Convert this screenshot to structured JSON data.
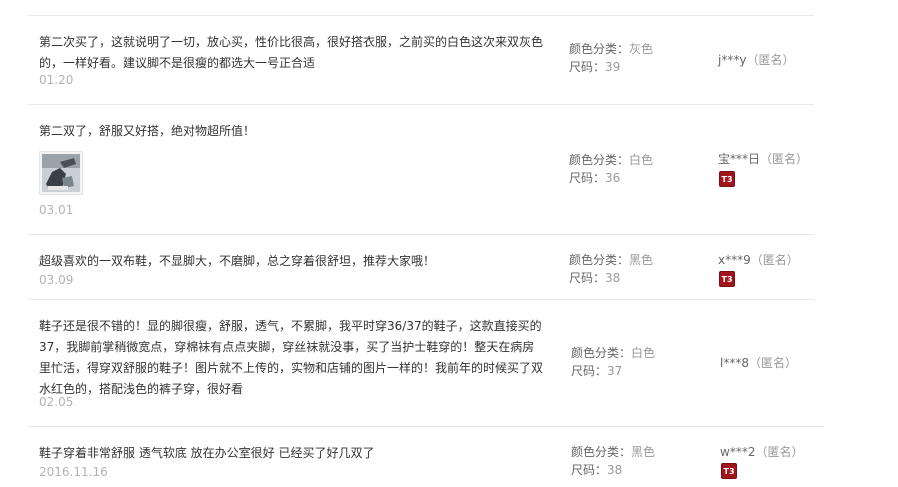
{
  "reviews": [
    {
      "content": "第二次买了，这就说明了一切，放心买，性价比很高，很好搭衣服，之前买的白色这次来双灰色的，一样好看。建议脚不是很瘦的都选大一号正合适",
      "date": "01.20",
      "color_label": "颜色分类：",
      "color_value": "灰色",
      "size_label": "尺码：",
      "size_value": "39",
      "user": "j***y",
      "anon": "（匿名）"
    },
    {
      "content": "第二双了，舒服又好搭，绝对物超所值！",
      "date": "03.01",
      "color_label": "颜色分类：",
      "color_value": "白色",
      "size_label": "尺码：",
      "size_value": "36",
      "user": "宝***日",
      "anon": "（匿名）",
      "badge": "T3"
    },
    {
      "content": "超级喜欢的一双布鞋，不显脚大，不磨脚，总之穿着很舒坦，推荐大家哦！",
      "date": "03.09",
      "color_label": "颜色分类：",
      "color_value": "黑色",
      "size_label": "尺码：",
      "size_value": "38",
      "user": "x***9",
      "anon": "（匿名）",
      "badge": "T3"
    },
    {
      "content": "鞋子还是很不错的！显的脚很瘦，舒服，透气，不累脚，我平时穿36/37的鞋子，这款直接买的37，我脚前掌稍微宽点，穿棉袜有点点夹脚，穿丝袜就没事，买了当护士鞋穿的！整天在病房里忙活，得穿双舒服的鞋子！图片就不上传的，实物和店铺的图片一样的！我前年的时候买了双水红色的，搭配浅色的裤子穿，很好看",
      "date": "02.05",
      "color_label": "颜色分类：",
      "color_value": "白色",
      "size_label": "尺码：",
      "size_value": "37",
      "user": "l***8",
      "anon": "（匿名）"
    },
    {
      "content": "鞋子穿着非常舒服 透气软底 放在办公室很好 已经买了好几双了",
      "date": "2016.11.16",
      "color_label": "颜色分类：",
      "color_value": "黑色",
      "size_label": "尺码：",
      "size_value": "38",
      "user": "w***2",
      "anon": "（匿名）",
      "badge": "T3"
    }
  ]
}
